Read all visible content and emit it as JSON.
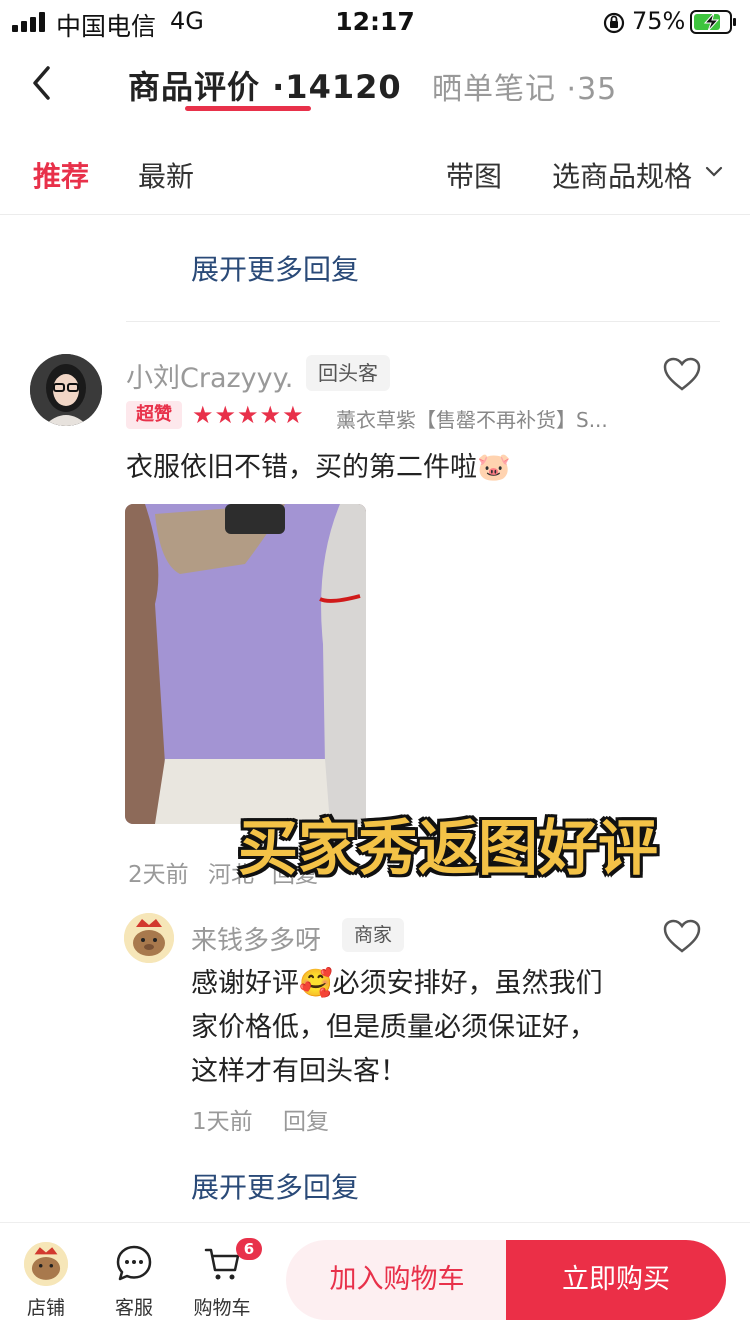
{
  "status": {
    "carrier": "中国电信",
    "network": "4G",
    "time": "12:17",
    "battery": "75%"
  },
  "header": {
    "tabs": [
      {
        "label": "商品评价 ·14120",
        "active": true
      },
      {
        "label": "晒单笔记 ·35",
        "active": false
      }
    ]
  },
  "filters": {
    "recommend": "推荐",
    "latest": "最新",
    "with_image": "带图",
    "spec": "选商品规格"
  },
  "expand_more_top": "展开更多回复",
  "review": {
    "username": "小刘Crazyyy.",
    "tag": "回头客",
    "badge": "超赞",
    "stars": "★★★★★",
    "rating": 5,
    "spec": "薰衣草紫【售罄不再补货】S...",
    "text": "衣服依旧不错，买的第二件啦🐷",
    "time": "2天前",
    "location": "河北",
    "reply_label": "回复"
  },
  "overlay_caption": "买家秀返图好评",
  "seller_reply": {
    "name": "来钱多多呀",
    "tag": "商家",
    "text": "感谢好评🥰必须安排好，虽然我们家价格低，但是质量必须保证好，这样才有回头客！",
    "time": "1天前",
    "reply_label": "回复"
  },
  "expand_more_bottom": "展开更多回复",
  "bottom_bar": {
    "shop": "店铺",
    "service": "客服",
    "cart": "购物车",
    "cart_count": "6",
    "add_to_cart": "加入购物车",
    "buy_now": "立即购买"
  },
  "colors": {
    "accent": "#e8314a",
    "link": "#2a4a78"
  }
}
